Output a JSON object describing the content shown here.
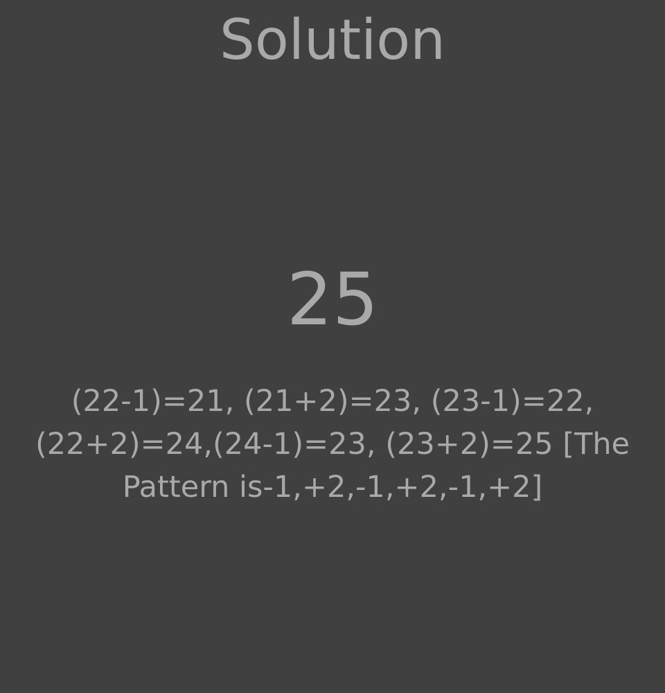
{
  "page": {
    "title": "Solution",
    "answer": "25",
    "explanation_lines": [
      "(22-1)=21, (21+2)=23, (23-1)=22,",
      "(22+2)=24,(24-1)=23, (23+2)=25  [The",
      "Pattern is-1,+2,-1,+2,-1,+2]"
    ]
  },
  "colors": {
    "background": "#404040",
    "text": "#a9a9a9"
  }
}
